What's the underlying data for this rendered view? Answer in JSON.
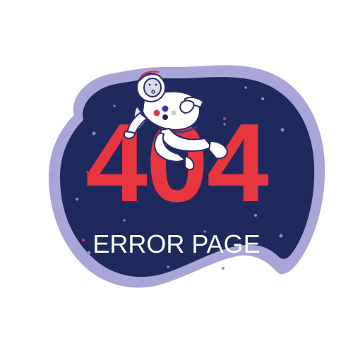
{
  "illustration": {
    "code": "404",
    "label": "ERROR PAGE",
    "icon": "astronaut-icon",
    "colors": {
      "background": "#ffffff",
      "outer_blob": "#a9a5d8",
      "space": "#1e2a5e",
      "code": "#e8353e",
      "label": "#ffffff",
      "stars": "#8d8fbf",
      "suit": "#ffffff",
      "suit_outline": "#2a2a6a",
      "accent_red": "#d63a44",
      "accent_blue": "#3a3f8f"
    }
  }
}
